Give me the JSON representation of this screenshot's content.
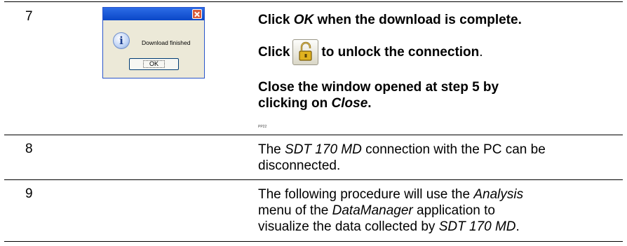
{
  "row7": {
    "step": "7",
    "dialog": {
      "message": "Download finished",
      "ok_label": "OK",
      "info_icon": "info-icon",
      "close_icon": "close-icon"
    },
    "line1_pre": "Click ",
    "line1_em": "OK",
    "line1_post": " when the download is complete.",
    "line2_pre": "Click",
    "line2_icon": "unlock-icon",
    "line2_post": "to unlock the connection",
    "line2_period": ".",
    "line3_a": "Close the window opened at step 5 by",
    "line3_b_pre": "clicking on ",
    "line3_b_em": "Close",
    "line3_b_post": ".",
    "tiny_code": "PP22"
  },
  "row8": {
    "step": "8",
    "l1_pre": "The ",
    "l1_em": "SDT 170 MD",
    "l1_post": " connection with the PC can be",
    "l2": "disconnected."
  },
  "row9": {
    "step": "9",
    "l1_pre": "The following procedure will use the ",
    "l1_em": "Analysis",
    "l2_em_pre": "menu of the ",
    "l2_em": "DataManager",
    "l2_post": " application to",
    "l3_pre": "visualize the data collected by ",
    "l3_em": "SDT 170 MD",
    "l3_post": "."
  },
  "colors": {
    "rule": "#000000",
    "titlebar": "#0a47c7",
    "close": "#d85a3a",
    "lock": "#e0b21f"
  }
}
